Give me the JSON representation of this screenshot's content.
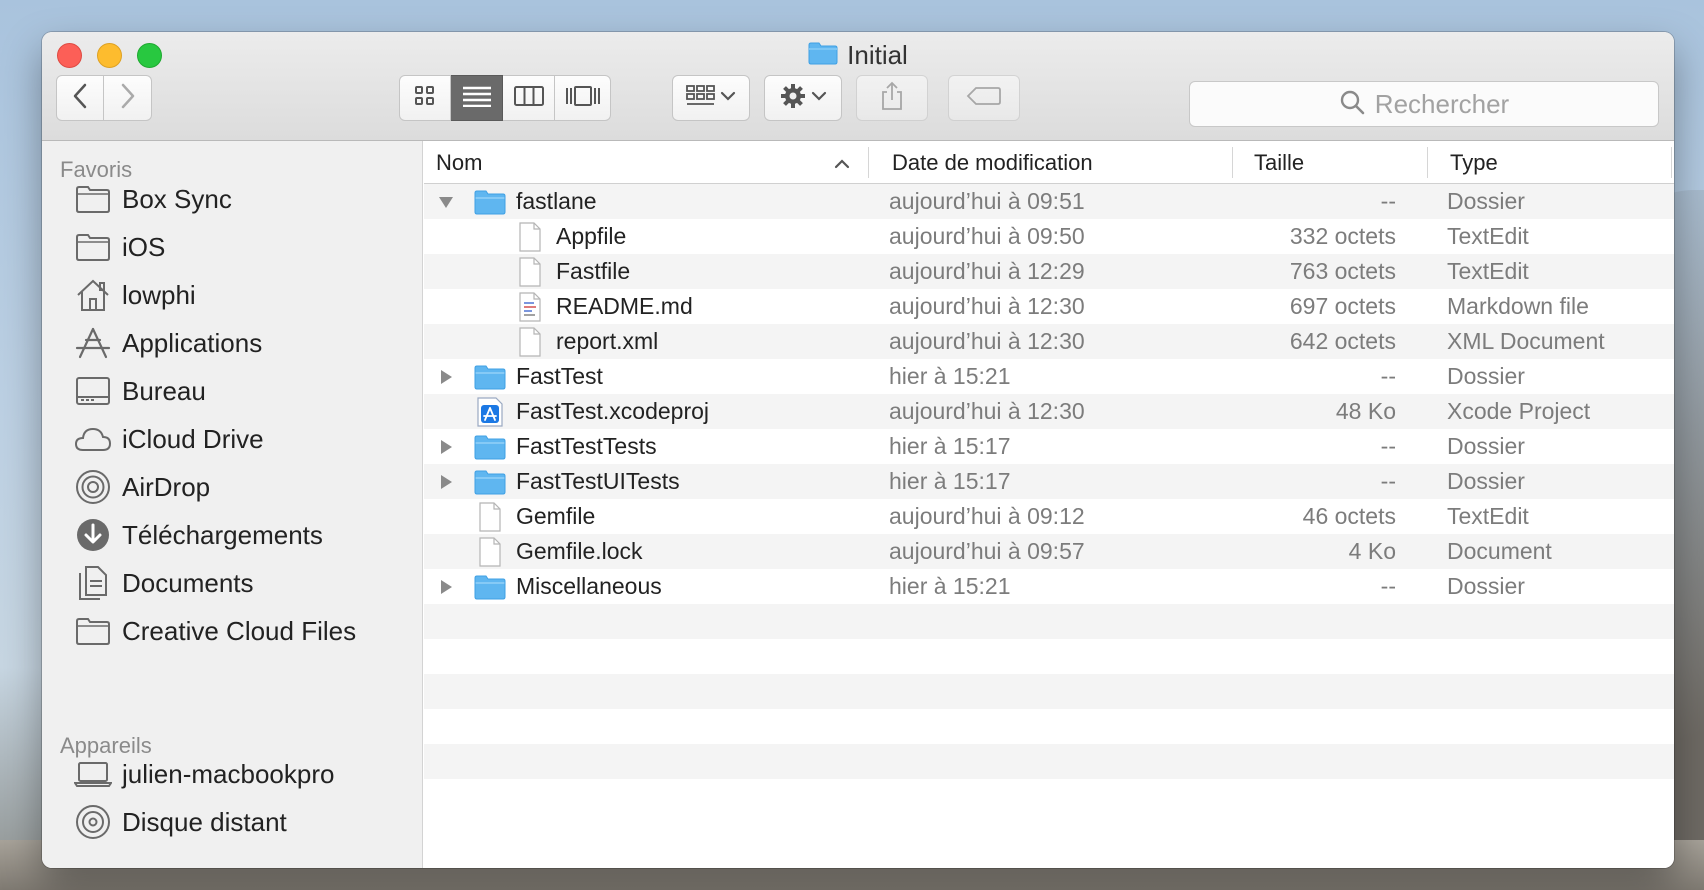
{
  "window": {
    "title": "Initial"
  },
  "search": {
    "placeholder": "Rechercher"
  },
  "sidebar": {
    "favorites_title": "Favoris",
    "favorites": [
      {
        "label": "Box Sync",
        "icon": "folder-icon"
      },
      {
        "label": "iOS",
        "icon": "folder-icon"
      },
      {
        "label": "lowphi",
        "icon": "home-icon"
      },
      {
        "label": "Applications",
        "icon": "applications-icon"
      },
      {
        "label": "Bureau",
        "icon": "desktop-icon"
      },
      {
        "label": "iCloud Drive",
        "icon": "cloud-icon"
      },
      {
        "label": "AirDrop",
        "icon": "airdrop-icon"
      },
      {
        "label": "Téléchargements",
        "icon": "downloads-icon"
      },
      {
        "label": "Documents",
        "icon": "documents-icon"
      },
      {
        "label": "Creative Cloud Files",
        "icon": "folder-icon"
      }
    ],
    "devices_title": "Appareils",
    "devices": [
      {
        "label": "julien-macbookpro",
        "icon": "laptop-icon"
      },
      {
        "label": "Disque distant",
        "icon": "disc-icon"
      }
    ]
  },
  "columns": {
    "name": "Nom",
    "date": "Date de modification",
    "size": "Taille",
    "type": "Type"
  },
  "files": [
    {
      "name": "fastlane",
      "date": "aujourd’hui à 09:51",
      "size": "--",
      "type": "Dossier",
      "kind": "folder",
      "indent": 0,
      "disclosure": "expanded"
    },
    {
      "name": "Appfile",
      "date": "aujourd’hui à 09:50",
      "size": "332 octets",
      "type": "TextEdit",
      "kind": "file",
      "indent": 1,
      "disclosure": "none"
    },
    {
      "name": "Fastfile",
      "date": "aujourd’hui à 12:29",
      "size": "763 octets",
      "type": "TextEdit",
      "kind": "file",
      "indent": 1,
      "disclosure": "none"
    },
    {
      "name": "README.md",
      "date": "aujourd’hui à 12:30",
      "size": "697 octets",
      "type": "Markdown file",
      "kind": "markdown",
      "indent": 1,
      "disclosure": "none"
    },
    {
      "name": "report.xml",
      "date": "aujourd’hui à 12:30",
      "size": "642 octets",
      "type": "XML Document",
      "kind": "file",
      "indent": 1,
      "disclosure": "none"
    },
    {
      "name": "FastTest",
      "date": "hier à 15:21",
      "size": "--",
      "type": "Dossier",
      "kind": "folder",
      "indent": 0,
      "disclosure": "collapsed"
    },
    {
      "name": "FastTest.xcodeproj",
      "date": "aujourd’hui à 12:30",
      "size": "48 Ko",
      "type": "Xcode Project",
      "kind": "xcode",
      "indent": 0,
      "disclosure": "none"
    },
    {
      "name": "FastTestTests",
      "date": "hier à 15:17",
      "size": "--",
      "type": "Dossier",
      "kind": "folder",
      "indent": 0,
      "disclosure": "collapsed"
    },
    {
      "name": "FastTestUITests",
      "date": "hier à 15:17",
      "size": "--",
      "type": "Dossier",
      "kind": "folder",
      "indent": 0,
      "disclosure": "collapsed"
    },
    {
      "name": "Gemfile",
      "date": "aujourd’hui à 09:12",
      "size": "46 octets",
      "type": "TextEdit",
      "kind": "file",
      "indent": 0,
      "disclosure": "none"
    },
    {
      "name": "Gemfile.lock",
      "date": "aujourd’hui à 09:57",
      "size": "4 Ko",
      "type": "Document",
      "kind": "file",
      "indent": 0,
      "disclosure": "none"
    },
    {
      "name": "Miscellaneous",
      "date": "hier à 15:21",
      "size": "--",
      "type": "Dossier",
      "kind": "folder",
      "indent": 0,
      "disclosure": "collapsed"
    }
  ],
  "colors": {
    "folder": "#5fb6f0",
    "folder_dark": "#3fa0e4",
    "accent": "#1b78e4"
  }
}
